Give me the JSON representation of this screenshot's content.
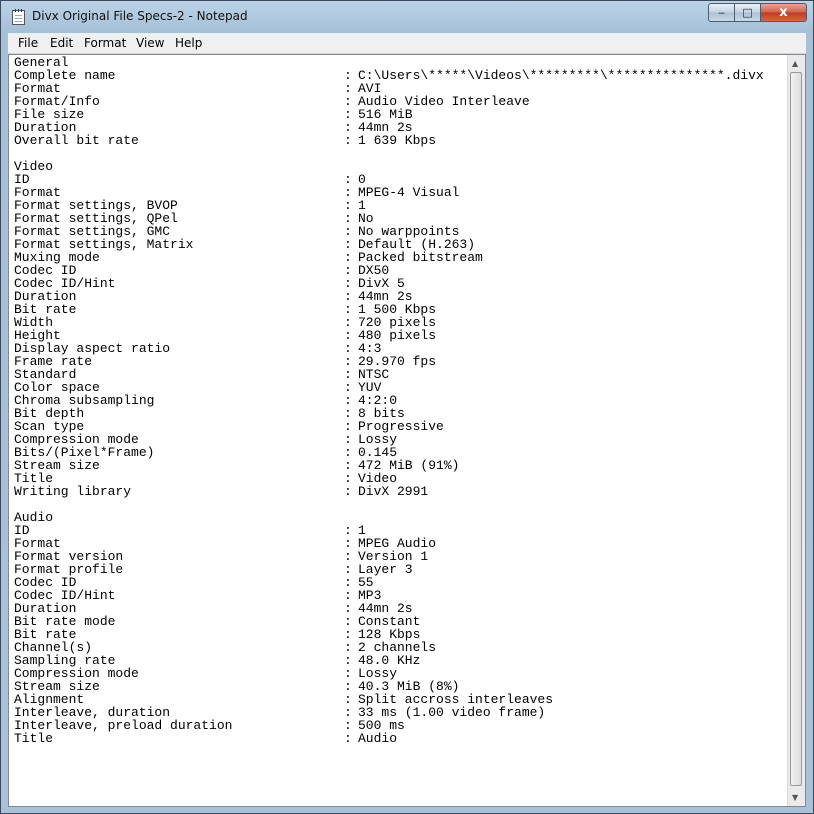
{
  "window": {
    "title": "Divx Original File Specs-2 - Notepad",
    "minimize_label": "‒",
    "maximize_label": "□",
    "close_label": "x"
  },
  "menu": [
    "File",
    "Edit",
    "Format",
    "View",
    "Help"
  ],
  "scrollbar": {
    "up": "▲",
    "down": "▼"
  },
  "lines": [
    {
      "k": "General",
      "v": ""
    },
    {
      "k": "Complete name",
      "v": "C:\\Users\\*****\\Videos\\*********\\***************.divx"
    },
    {
      "k": "Format",
      "v": "AVI"
    },
    {
      "k": "Format/Info",
      "v": "Audio Video Interleave"
    },
    {
      "k": "File size",
      "v": "516 MiB"
    },
    {
      "k": "Duration",
      "v": "44mn 2s"
    },
    {
      "k": "Overall bit rate",
      "v": "1 639 Kbps"
    },
    {
      "k": "",
      "v": ""
    },
    {
      "k": "Video",
      "v": ""
    },
    {
      "k": "ID",
      "v": "0"
    },
    {
      "k": "Format",
      "v": "MPEG-4 Visual"
    },
    {
      "k": "Format settings, BVOP",
      "v": "1"
    },
    {
      "k": "Format settings, QPel",
      "v": "No"
    },
    {
      "k": "Format settings, GMC",
      "v": "No warppoints"
    },
    {
      "k": "Format settings, Matrix",
      "v": "Default (H.263)"
    },
    {
      "k": "Muxing mode",
      "v": "Packed bitstream"
    },
    {
      "k": "Codec ID",
      "v": "DX50"
    },
    {
      "k": "Codec ID/Hint",
      "v": "DivX 5"
    },
    {
      "k": "Duration",
      "v": "44mn 2s"
    },
    {
      "k": "Bit rate",
      "v": "1 500 Kbps"
    },
    {
      "k": "Width",
      "v": "720 pixels"
    },
    {
      "k": "Height",
      "v": "480 pixels"
    },
    {
      "k": "Display aspect ratio",
      "v": "4:3"
    },
    {
      "k": "Frame rate",
      "v": "29.970 fps"
    },
    {
      "k": "Standard",
      "v": "NTSC"
    },
    {
      "k": "Color space",
      "v": "YUV"
    },
    {
      "k": "Chroma subsampling",
      "v": "4:2:0"
    },
    {
      "k": "Bit depth",
      "v": "8 bits"
    },
    {
      "k": "Scan type",
      "v": "Progressive"
    },
    {
      "k": "Compression mode",
      "v": "Lossy"
    },
    {
      "k": "Bits/(Pixel*Frame)",
      "v": "0.145"
    },
    {
      "k": "Stream size",
      "v": "472 MiB (91%)"
    },
    {
      "k": "Title",
      "v": "Video"
    },
    {
      "k": "Writing library",
      "v": "DivX 2991"
    },
    {
      "k": "",
      "v": ""
    },
    {
      "k": "Audio",
      "v": ""
    },
    {
      "k": "ID",
      "v": "1"
    },
    {
      "k": "Format",
      "v": "MPEG Audio"
    },
    {
      "k": "Format version",
      "v": "Version 1"
    },
    {
      "k": "Format profile",
      "v": "Layer 3"
    },
    {
      "k": "Codec ID",
      "v": "55"
    },
    {
      "k": "Codec ID/Hint",
      "v": "MP3"
    },
    {
      "k": "Duration",
      "v": "44mn 2s"
    },
    {
      "k": "Bit rate mode",
      "v": "Constant"
    },
    {
      "k": "Bit rate",
      "v": "128 Kbps"
    },
    {
      "k": "Channel(s)",
      "v": "2 channels"
    },
    {
      "k": "Sampling rate",
      "v": "48.0 KHz"
    },
    {
      "k": "Compression mode",
      "v": "Lossy"
    },
    {
      "k": "Stream size",
      "v": "40.3 MiB (8%)"
    },
    {
      "k": "Alignment",
      "v": "Split accross interleaves"
    },
    {
      "k": "Interleave, duration",
      "v": "33 ms (1.00 video frame)"
    },
    {
      "k": "Interleave, preload duration",
      "v": "500 ms"
    },
    {
      "k": "Title",
      "v": "Audio"
    }
  ]
}
